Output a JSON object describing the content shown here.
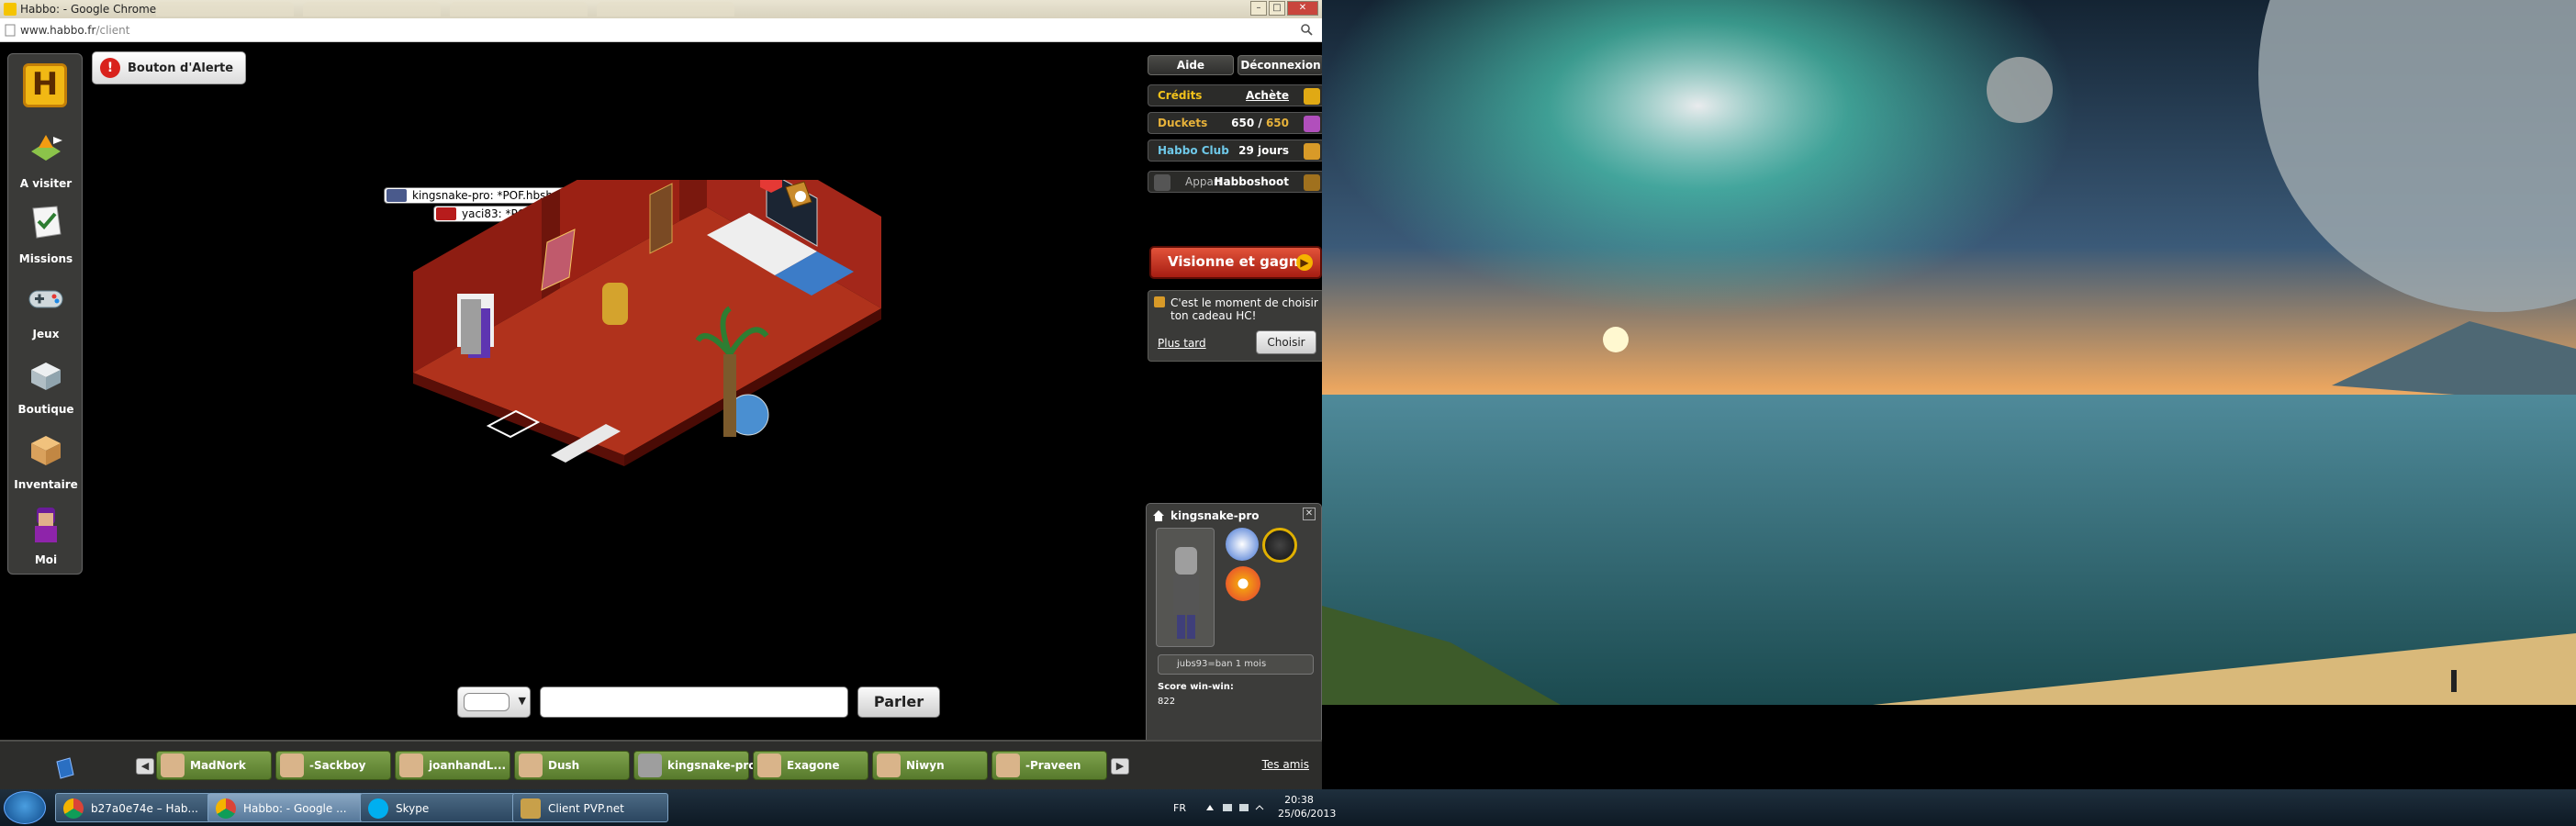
{
  "browser": {
    "window_title": "Habbo: - Google Chrome",
    "url_host": "www.habbo.fr",
    "url_path": "/client"
  },
  "left_nav": {
    "items": [
      {
        "label": "A visiter",
        "icon": "hotel-view-icon"
      },
      {
        "label": "Missions",
        "icon": "missions-icon"
      },
      {
        "label": "Jeux",
        "icon": "gamepad-icon"
      },
      {
        "label": "Boutique",
        "icon": "shop-icon"
      },
      {
        "label": "Inventaire",
        "icon": "inventory-box-icon"
      },
      {
        "label": "Moi",
        "icon": "avatar-head-icon"
      }
    ]
  },
  "alert_button": {
    "label": "Bouton d'Alerte"
  },
  "chat_bubbles": [
    {
      "text": "kingsnake-pro: *POF.hbsh.fr*"
    },
    {
      "text": "yaci83: *POF.hbsh.fr*"
    }
  ],
  "top_right": {
    "help": "Aide",
    "logout": "Déconnexion"
  },
  "purse": {
    "credits_label": "Crédits",
    "credits_action": "Achète",
    "duckets_label": "Duckets",
    "duckets_value": "650",
    "duckets_sep": " / ",
    "duckets_max": "650",
    "club_label": "Habbo Club",
    "club_value": "29 jours",
    "room_prefix": "Appart :",
    "room_name": "Habboshoot"
  },
  "promo": {
    "label": "Visionne et gagne"
  },
  "hc_gift": {
    "text": "C'est le moment de choisir ton cadeau HC!",
    "later": "Plus tard",
    "choose": "Choisir"
  },
  "profile": {
    "name": "kingsnake-pro",
    "motto": "jubs93=ban 1 mois",
    "score_label": "Score win-win:",
    "score_value": "822"
  },
  "chat": {
    "send": "Parler"
  },
  "friends": {
    "list": [
      "MadNork",
      "-Sackboy",
      "joanhandL...",
      "Dush",
      "kingsnake-pro",
      "Exagone",
      "Niwyn",
      "-Praveen"
    ],
    "all_friends_link": "Tes amis"
  },
  "taskbar": {
    "tasks": [
      "b27a0e74e – Hab...",
      "Habbo: - Google ...",
      "Skype",
      "Client PVP.net"
    ],
    "language": "FR",
    "time": "20:38",
    "date": "25/06/2013"
  },
  "colors": {
    "credits": "#f2c21b",
    "duckets": "#e7b23a",
    "club": "#6ec8e8",
    "friend_bg": "#6b8e3b",
    "promo": "#c9321f"
  }
}
